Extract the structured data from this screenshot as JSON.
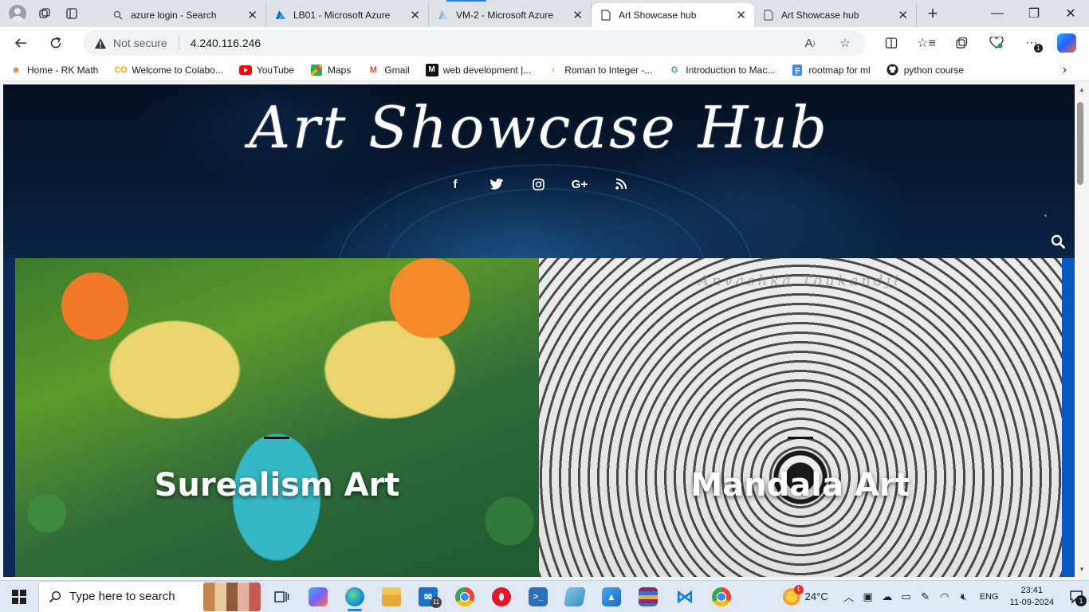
{
  "browser": {
    "tabs": [
      {
        "title": "azure login - Search",
        "icon": "search-icon",
        "active": false
      },
      {
        "title": "LB01 - Microsoft Azure",
        "icon": "azure-icon",
        "active": false
      },
      {
        "title": "VM-2 - Microsoft Azure",
        "icon": "azure-icon",
        "active": false
      },
      {
        "title": "Art Showcase hub",
        "icon": "page-icon",
        "active": true
      },
      {
        "title": "Art Showcase hub",
        "icon": "page-icon",
        "active": false
      }
    ],
    "new_tab_label": "+",
    "address": {
      "security_label": "Not secure",
      "url": "4.240.116.246"
    },
    "extension_badge": "1",
    "bookmarks": [
      {
        "label": "Home - RK Math",
        "icon": "rk-math-icon"
      },
      {
        "label": "Welcome to Colabo...",
        "icon": "colab-icon"
      },
      {
        "label": "YouTube",
        "icon": "youtube-icon"
      },
      {
        "label": "Maps",
        "icon": "maps-icon"
      },
      {
        "label": "Gmail",
        "icon": "gmail-icon"
      },
      {
        "label": "web development |...",
        "icon": "m-icon"
      },
      {
        "label": "Roman to Integer -...",
        "icon": "leetcode-icon"
      },
      {
        "label": "Introduction to Mac...",
        "icon": "google-icon"
      },
      {
        "label": "rootmap for ml",
        "icon": "doc-icon"
      },
      {
        "label": "python course",
        "icon": "github-icon"
      }
    ]
  },
  "site": {
    "title": "Art Showcase Hub",
    "social": [
      "facebook-icon",
      "twitter-icon",
      "instagram-icon",
      "google-plus-icon",
      "rss-icon"
    ],
    "social_glyphs": [
      "f",
      "🐦",
      "◎",
      "G+",
      "◉"
    ],
    "cards": [
      {
        "title": "Surealism Art"
      },
      {
        "title": "Mandala Art",
        "watermark": "Anvashka Toukandji"
      }
    ]
  },
  "taskbar": {
    "search_placeholder": "Type here to search",
    "mail_badge": "11",
    "weather": {
      "temp": "24°C",
      "alert_count": "1"
    },
    "language": "ENG",
    "time": "23:41",
    "date": "11-09-2024",
    "notification_count": "1"
  },
  "colors": {
    "accent": "#2a7de1",
    "hero_dark": "#041021",
    "card_frame": "#0a57c2"
  }
}
